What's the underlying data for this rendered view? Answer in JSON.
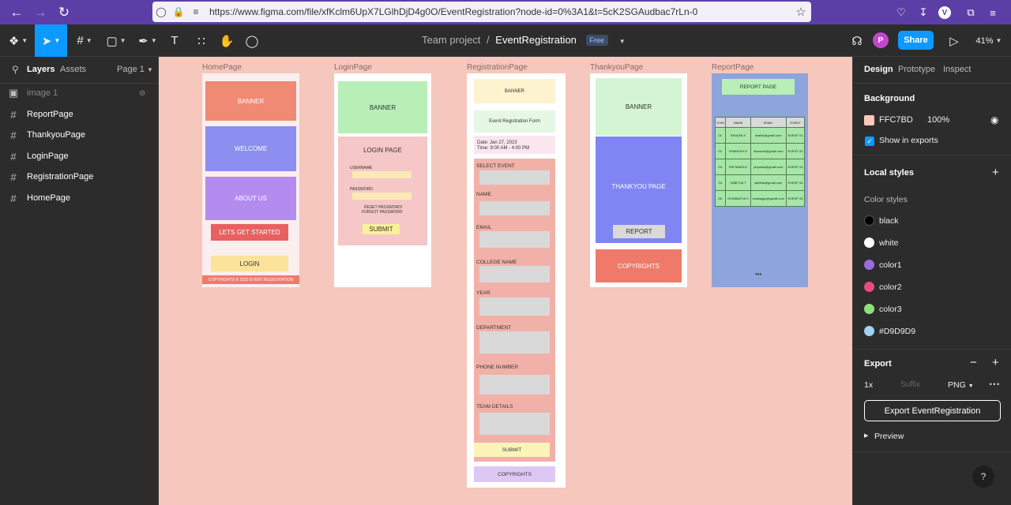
{
  "browser": {
    "url": "https://www.figma.com/file/xfKclm6UpX7LGlhDjD4g0O/EventRegistration?node-id=0%3A1&t=5cK2SGAudbac7rLn-0",
    "profile_initial": "V"
  },
  "toolbar": {
    "project": "Team project",
    "separator": "/",
    "file_name": "EventRegistration",
    "plan_badge": "Free",
    "share_label": "Share",
    "avatar_initial": "P",
    "zoom": "41%"
  },
  "left_panel": {
    "tabs": [
      "Layers",
      "Assets"
    ],
    "page_selector": "Page 1",
    "layers": [
      {
        "name": "image 1",
        "type": "image"
      },
      {
        "name": "ReportPage",
        "type": "frame"
      },
      {
        "name": "ThankyouPage",
        "type": "frame"
      },
      {
        "name": "LoginPage",
        "type": "frame"
      },
      {
        "name": "RegistrationPage",
        "type": "frame"
      },
      {
        "name": "HomePage",
        "type": "frame"
      }
    ]
  },
  "canvas": {
    "background": "#FFC7BD",
    "home": {
      "label": "HomePage",
      "banner": "BANNER",
      "welcome": "WELCOME",
      "about": "ABOUT US",
      "cta": "LETS GET STARTED",
      "login": "LOGIN",
      "footer": "COPYRIGHTS © 2023 EVENT REGISTRATION"
    },
    "login": {
      "label": "LoginPage",
      "banner": "BANNER",
      "title": "LOGIN PAGE",
      "username": "USERNAME",
      "password": "PASSWORD",
      "reset": "RESET PASSWORD/",
      "forgot": "FORGOT PASSWORD",
      "submit": "SUBMIT"
    },
    "registration": {
      "label": "RegistrationPage",
      "banner": "BANNER",
      "form_title": "Event Registration Form",
      "date": "Date: Jan 27, 2023",
      "time": "Time: 9:00 AM - 4:00 PM",
      "fields": [
        "SELECT EVENT",
        "NAME",
        "EMAIL",
        "COLLEGE NAME",
        "YEAR",
        "DEPARTMENT",
        "PHONE NUMBER",
        "TEAM DETAILS"
      ],
      "submit": "SUBMIT",
      "footer": "COPYRIGHTS"
    },
    "thankyou": {
      "label": "ThankyouPage",
      "banner": "BANNER",
      "title": "THANKYOU PAGE",
      "report": "REPORT",
      "footer": "COPYRIGHTS"
    },
    "report": {
      "label": "ReportPage",
      "title": "REPORT PAGE",
      "headers": [
        "S.NO",
        "NAME",
        "EMAIL",
        "EVENT"
      ],
      "rows": [
        [
          "01.",
          "SHALINI K",
          "shalini@gmail.com",
          "EVENT 01"
        ],
        [
          "02.",
          "DHANUSH K",
          "dhanush@gmail.com",
          "EVENT 02"
        ],
        [
          "03.",
          "PRIYANKA K",
          "priyanka@gmail.com",
          "EVENT 03"
        ],
        [
          "04.",
          "SABITHA T",
          "sabitha@gmail.com",
          "EVENT 04"
        ],
        [
          "05.",
          "SOWBAGYA S",
          "sowbagya@gmail.com",
          "EVENT 05"
        ]
      ],
      "more": "•••"
    }
  },
  "right_panel": {
    "tabs": [
      "Design",
      "Prototype",
      "Inspect"
    ],
    "background_heading": "Background",
    "background_hex": "FFC7BD",
    "background_opacity": "100%",
    "show_in_exports": "Show in exports",
    "local_styles": "Local styles",
    "color_styles_heading": "Color styles",
    "color_styles": [
      {
        "name": "black",
        "color": "#000000"
      },
      {
        "name": "white",
        "color": "#FFFFFF"
      },
      {
        "name": "color1",
        "color": "#9B6BE0"
      },
      {
        "name": "color2",
        "color": "#E84D7A"
      },
      {
        "name": "color3",
        "color": "#8EE07A"
      },
      {
        "name": "#D9D9D9",
        "color": "#9FD3F0"
      }
    ],
    "export_heading": "Export",
    "export_scale": "1x",
    "export_suffix_placeholder": "Suffix",
    "export_format": "PNG",
    "export_button": "Export EventRegistration",
    "preview": "Preview",
    "help": "?"
  }
}
